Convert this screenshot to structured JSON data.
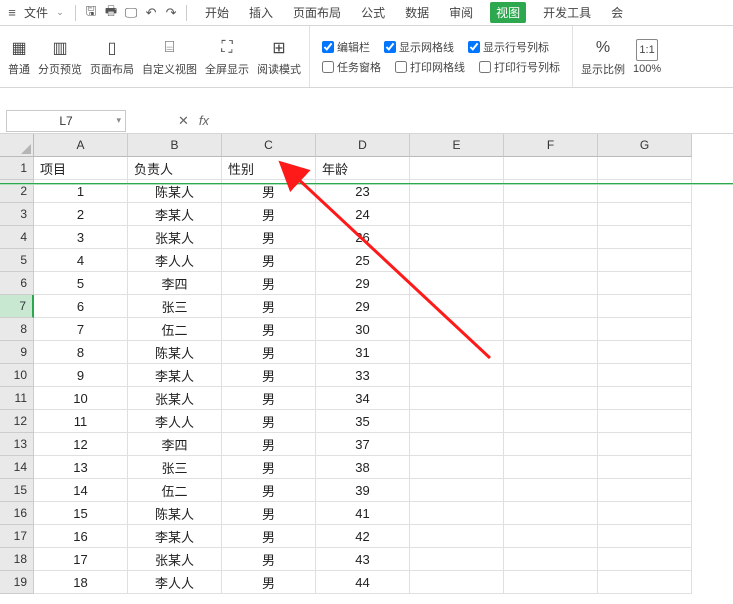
{
  "menu": {
    "file_label": "文件",
    "tabs": [
      "开始",
      "插入",
      "页面布局",
      "公式",
      "数据",
      "审阅",
      "视图",
      "开发工具",
      "会"
    ],
    "active_tab_index": 6
  },
  "ribbon": {
    "normal": "普通",
    "page_preview": "分页预览",
    "page_layout": "页面布局",
    "custom_view": "自定义视图",
    "fullscreen": "全屏显示",
    "reading_mode": "阅读模式",
    "checks": {
      "edit_bar": "编辑栏",
      "task_pane": "任务窗格",
      "show_gridlines": "显示网格线",
      "print_gridlines": "打印网格线",
      "show_rowcol": "显示行号列标",
      "print_rowcol": "打印行号列标"
    },
    "zoom": "显示比例",
    "zoom_pct": "100%"
  },
  "formula": {
    "cell_ref": "L7",
    "fx": "fx"
  },
  "columns": [
    "A",
    "B",
    "C",
    "D",
    "E",
    "F",
    "G"
  ],
  "row_headers": [
    1,
    2,
    3,
    4,
    5,
    6,
    7,
    8,
    9,
    10,
    11,
    12,
    13,
    14,
    15,
    16,
    17,
    18,
    19
  ],
  "selected_row": 7,
  "data": {
    "headers": [
      "项目",
      "负责人",
      "性别",
      "年龄"
    ],
    "rows": [
      [
        1,
        "陈某人",
        "男",
        23
      ],
      [
        2,
        "李某人",
        "男",
        24
      ],
      [
        3,
        "张某人",
        "男",
        26
      ],
      [
        4,
        "李人人",
        "男",
        25
      ],
      [
        5,
        "李四",
        "男",
        29
      ],
      [
        6,
        "张三",
        "男",
        29
      ],
      [
        7,
        "伍二",
        "男",
        30
      ],
      [
        8,
        "陈某人",
        "男",
        31
      ],
      [
        9,
        "李某人",
        "男",
        33
      ],
      [
        10,
        "张某人",
        "男",
        34
      ],
      [
        11,
        "李人人",
        "男",
        35
      ],
      [
        12,
        "李四",
        "男",
        37
      ],
      [
        13,
        "张三",
        "男",
        38
      ],
      [
        14,
        "伍二",
        "男",
        39
      ],
      [
        15,
        "陈某人",
        "男",
        41
      ],
      [
        16,
        "李某人",
        "男",
        42
      ],
      [
        17,
        "张某人",
        "男",
        43
      ],
      [
        18,
        "李人人",
        "男",
        44
      ]
    ]
  }
}
